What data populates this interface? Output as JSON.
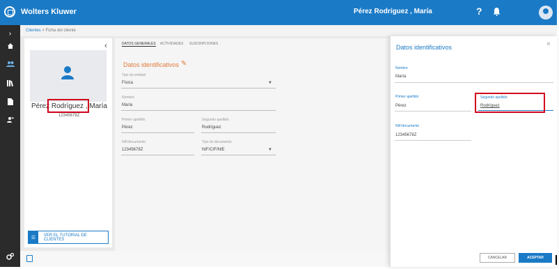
{
  "header": {
    "brand": "Wolters Kluwer",
    "user": "Pérez Rodríguez , María",
    "help": "?"
  },
  "breadcrumb": {
    "root": "Clientes",
    "separator": ">",
    "current": "Ficha del cliente"
  },
  "client": {
    "name": "Pérez Rodríguez , María",
    "nif": "12345678Z"
  },
  "tutorial_button": "VER EL TUTORIAL DE CLIENTES",
  "tabs": [
    "DATOS GENERALES",
    "ACTIVIDADES",
    "SUSCRIPCIONES"
  ],
  "section": {
    "title": "Datos identificativos",
    "fields": {
      "tipo_entidad": {
        "label": "Tipo de entidad",
        "value": "Física"
      },
      "nombre": {
        "label": "Nombre",
        "value": "María"
      },
      "primer_apellido": {
        "label": "Primer apellido",
        "value": "Pérez"
      },
      "segundo_apellido": {
        "label": "Segundo apellido",
        "value": "Rodríguez"
      },
      "nif": {
        "label": "NIF/documento",
        "value": "12345678Z"
      },
      "tipo_documento": {
        "label": "Tipo de documento",
        "value": "NIF/CIF/NIE"
      }
    }
  },
  "panel": {
    "title": "Datos identificativos",
    "close": "×",
    "nombre": {
      "label": "Nombre",
      "value": "María"
    },
    "primer_apellido": {
      "label": "Primer apellido",
      "value": "Pérez"
    },
    "segundo_apellido": {
      "label": "Segundo apellido",
      "value": "Rodríguez"
    },
    "nif": {
      "label": "NIF/documento",
      "value": "12345678Z"
    },
    "cancel": "CANCELAR",
    "accept": "ACEPTAR"
  },
  "colors": {
    "brand": "#1a7ac6",
    "accent": "#e07a3a",
    "highlight": "#d0021b",
    "sidebar": "#2b2b2b"
  }
}
